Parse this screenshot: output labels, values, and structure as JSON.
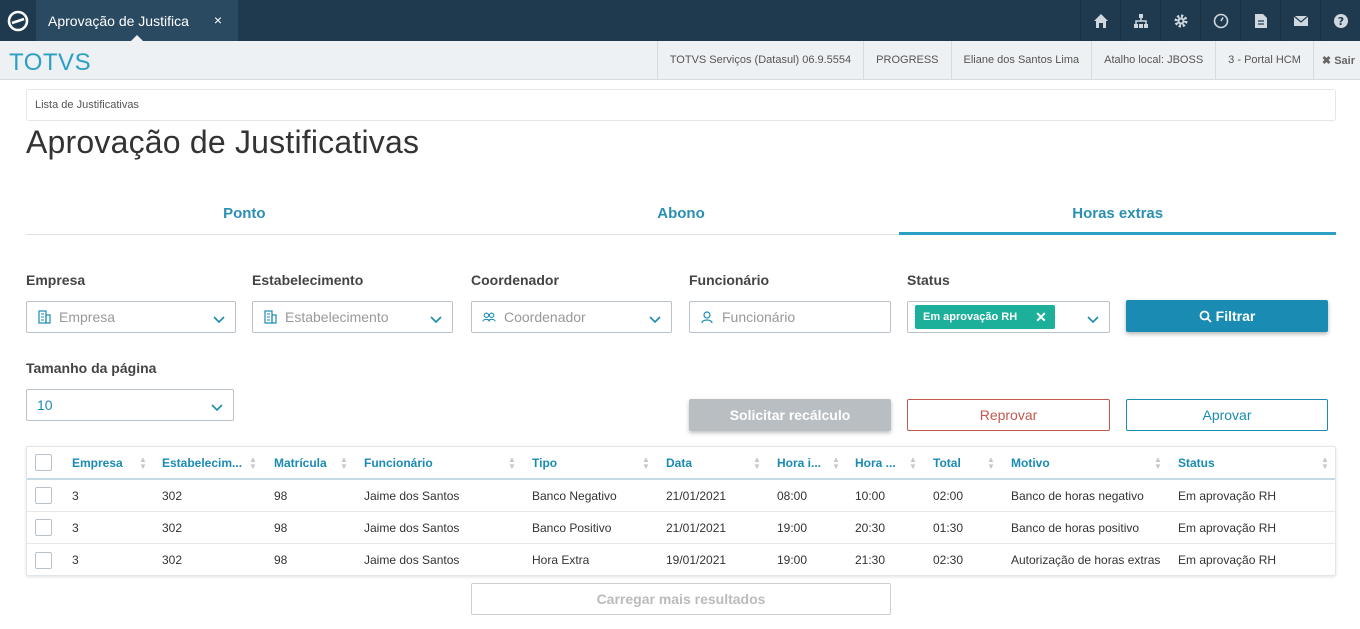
{
  "topbar": {
    "tab_label": "Aprovação de Justifica",
    "tab_close": "×",
    "icons": [
      "home-icon",
      "sitemap-icon",
      "gear-icon",
      "clock-icon",
      "document-icon",
      "mail-icon",
      "help-icon"
    ]
  },
  "infobar": {
    "brand": "TOTVS",
    "items": [
      "TOTVS Serviços (Datasul) 06.9.5554",
      "PROGRESS",
      "Eliane dos Santos Lima",
      "Atalho local: JBOSS",
      "3 - Portal HCM"
    ],
    "logout": "✖ Sair"
  },
  "breadcrumb": "Lista de Justificativas",
  "page_title": "Aprovação de Justificativas",
  "tabs": [
    "Ponto",
    "Abono",
    "Horas extras"
  ],
  "filters": {
    "empresa": {
      "label": "Empresa",
      "placeholder": "Empresa"
    },
    "estabelecimento": {
      "label": "Estabelecimento",
      "placeholder": "Estabelecimento"
    },
    "coordenador": {
      "label": "Coordenador",
      "placeholder": "Coordenador"
    },
    "funcionario": {
      "label": "Funcionário",
      "placeholder": "Funcionário"
    },
    "status": {
      "label": "Status",
      "chip": "Em aprovação RH"
    },
    "filter_button": "Filtrar",
    "page_size": {
      "label": "Tamanho da página",
      "value": "10"
    }
  },
  "actions": {
    "recalc": "Solicitar recálculo",
    "reject": "Reprovar",
    "approve": "Aprovar",
    "load_more": "Carregar mais resultados"
  },
  "table": {
    "headers": [
      "Empresa",
      "Estabelecim...",
      "Matrícula",
      "Funcionário",
      "Tipo",
      "Data",
      "Hora i...",
      "Hora ...",
      "Total",
      "Motivo",
      "Status"
    ],
    "rows": [
      [
        "3",
        "302",
        "98",
        "Jaime dos Santos",
        "Banco Negativo",
        "21/01/2021",
        "08:00",
        "10:00",
        "02:00",
        "Banco de horas negativo",
        "Em aprovação RH"
      ],
      [
        "3",
        "302",
        "98",
        "Jaime dos Santos",
        "Banco Positivo",
        "21/01/2021",
        "19:00",
        "20:30",
        "01:30",
        "Banco de horas positivo",
        "Em aprovação RH"
      ],
      [
        "3",
        "302",
        "98",
        "Jaime dos Santos",
        "Hora Extra",
        "19/01/2021",
        "19:00",
        "21:30",
        "02:30",
        "Autorização de horas extras",
        "Em aprovação RH"
      ]
    ]
  },
  "colors": {
    "topbar": "#1f3a4f",
    "accent": "#1a8bb3",
    "chip": "#1cb09a",
    "danger": "#c4584e"
  }
}
